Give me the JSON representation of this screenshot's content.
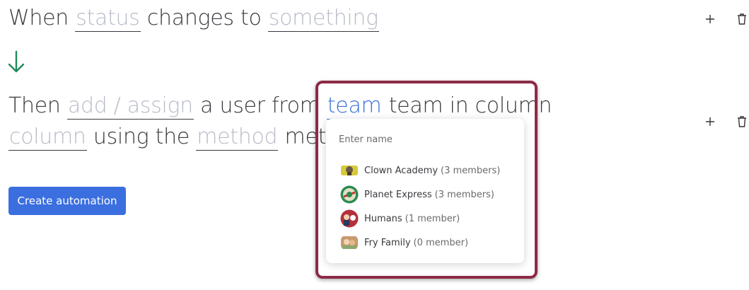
{
  "rule1": {
    "prefix": "When",
    "field": "status",
    "middle": "changes to",
    "value": "something"
  },
  "rule2": {
    "prefix": "Then",
    "action": "add / assign",
    "middle1": "a user from",
    "team": "team",
    "middle2": "team in column",
    "column": "column",
    "middle3": "using the",
    "method": "method",
    "tail": "met"
  },
  "create_button": "Create automation",
  "dropdown": {
    "placeholder": "Enter name",
    "teams": [
      {
        "name": "Clown Academy",
        "count": "(3 members)",
        "icon": "clown-academy-avatar",
        "color": "#d8c93a"
      },
      {
        "name": "Planet Express",
        "count": "(3 members)",
        "icon": "planet-express-avatar",
        "color": "#2b8a4f"
      },
      {
        "name": "Humans",
        "count": "(1 member)",
        "icon": "humans-avatar",
        "color": "#b3313b"
      },
      {
        "name": "Fry Family",
        "count": "(0 member)",
        "icon": "fry-family-avatar",
        "color": "#c89a6e"
      }
    ]
  },
  "colors": {
    "accent": "#3b6fe0",
    "arrow": "#1f8a5a",
    "highlight": "#8c2a47"
  }
}
